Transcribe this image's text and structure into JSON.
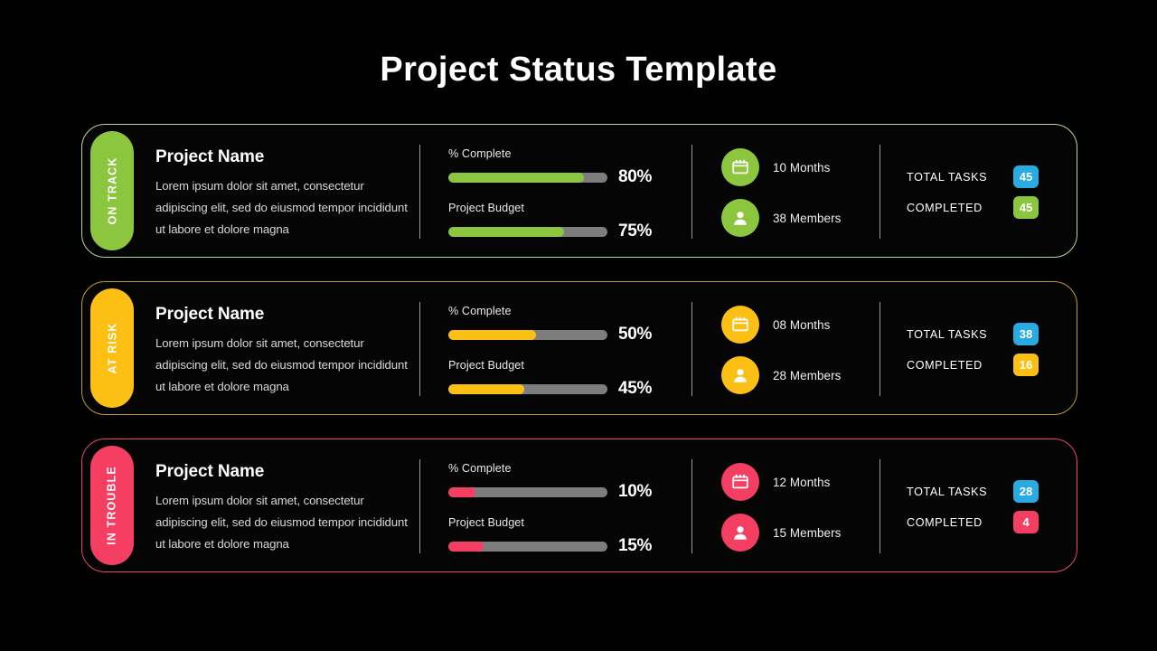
{
  "title": "Project Status Template",
  "colors": {
    "background": "#000000",
    "on_track": "#8cc63f",
    "at_risk": "#fcc015",
    "in_trouble": "#f43f63",
    "badge_blue": "#29abe2",
    "track_gray": "#7d7d80",
    "title_text": "#ffffff"
  },
  "cards": [
    {
      "status": "ON TRACK",
      "theme": "green",
      "project_name": "Project Name",
      "description": "Lorem ipsum dolor sit amet, consectetur adipiscing elit, sed do eiusmod tempor incididunt ut labore et dolore magna",
      "bars": [
        {
          "label": "% Complete",
          "value": "80%",
          "fill_pct": 85
        },
        {
          "label": "Project Budget",
          "value": "75%",
          "fill_pct": 73
        }
      ],
      "meta": [
        {
          "icon": "calendar-icon",
          "text": "10 Months"
        },
        {
          "icon": "person-icon",
          "text": "38 Members"
        }
      ],
      "tasks": [
        {
          "label": "TOTAL TASKS",
          "value": "45",
          "badge": "blue"
        },
        {
          "label": "COMPLETED",
          "value": "45",
          "badge": "accent"
        }
      ]
    },
    {
      "status": "AT RISK",
      "theme": "yellow",
      "project_name": "Project Name",
      "description": "Lorem ipsum dolor sit amet, consectetur adipiscing elit, sed do eiusmod tempor incididunt ut labore et dolore magna",
      "bars": [
        {
          "label": "% Complete",
          "value": "50%",
          "fill_pct": 55
        },
        {
          "label": "Project Budget",
          "value": "45%",
          "fill_pct": 48
        }
      ],
      "meta": [
        {
          "icon": "calendar-icon",
          "text": "08 Months"
        },
        {
          "icon": "person-icon",
          "text": "28 Members"
        }
      ],
      "tasks": [
        {
          "label": "TOTAL TASKS",
          "value": "38",
          "badge": "blue"
        },
        {
          "label": "COMPLETED",
          "value": "16",
          "badge": "accent"
        }
      ]
    },
    {
      "status": "IN TROUBLE",
      "theme": "pink",
      "project_name": "Project Name",
      "description": "Lorem ipsum dolor sit amet, consectetur adipiscing elit, sed do eiusmod tempor incididunt ut labore et dolore magna",
      "bars": [
        {
          "label": "% Complete",
          "value": "10%",
          "fill_pct": 17
        },
        {
          "label": "Project Budget",
          "value": "15%",
          "fill_pct": 22
        }
      ],
      "meta": [
        {
          "icon": "calendar-icon",
          "text": "12 Months"
        },
        {
          "icon": "person-icon",
          "text": "15 Members"
        }
      ],
      "tasks": [
        {
          "label": "TOTAL TASKS",
          "value": "28",
          "badge": "blue"
        },
        {
          "label": "COMPLETED",
          "value": "4",
          "badge": "accent"
        }
      ]
    }
  ]
}
